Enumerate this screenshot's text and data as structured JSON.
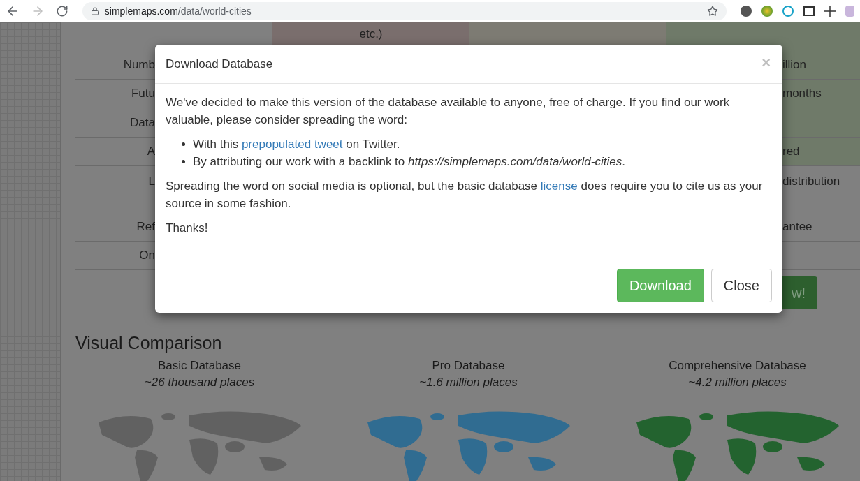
{
  "browser": {
    "url_host": "simplemaps.com",
    "url_path": "/data/world-cities"
  },
  "table": {
    "header_fragment": "etc.)",
    "rows": [
      {
        "label": "Numb",
        "value": "illion",
        "highlighted": true,
        "kind": "single"
      },
      {
        "label": "Futu",
        "value": "months",
        "highlighted": true,
        "kind": "single"
      },
      {
        "label": "Data",
        "highlighted": true,
        "kind": "single"
      },
      {
        "label": "A",
        "value": "red",
        "highlighted": true,
        "kind": "single"
      },
      {
        "label": "L",
        "value": "distribution",
        "highlighted": false,
        "kind": "double"
      },
      {
        "label": "Ref",
        "value": "antee",
        "highlighted": false,
        "kind": "single"
      },
      {
        "label": "On",
        "highlighted": false,
        "kind": "single"
      }
    ],
    "cta_fragment": "w!"
  },
  "comparison": {
    "heading": "Visual Comparison",
    "items": [
      {
        "title": "Basic Database",
        "subtitle": "~26 thousand places"
      },
      {
        "title": "Pro Database",
        "subtitle": "~1.6 million places"
      },
      {
        "title": "Comprehensive Database",
        "subtitle": "~4.2 million places"
      }
    ]
  },
  "modal": {
    "title": "Download Database",
    "close": "×",
    "intro": "We've decided to make this version of the database available to anyone, free of charge. If you find our work valuable, please consider spreading the word:",
    "bullets": [
      {
        "before": "With this ",
        "link": "prepopulated tweet",
        "after": " on Twitter."
      },
      {
        "before": "By attributing our work with a backlink to *https://simplemaps.com/data/world-cities*."
      }
    ],
    "note": {
      "before": "Spreading the word on social media is optional, but the basic database ",
      "link": "license",
      "after": " does require you to cite us as your source in some fashion."
    },
    "thanks": "Thanks!",
    "buttons": [
      {
        "label": "Download",
        "kind": "primary"
      },
      {
        "label": "Close",
        "kind": "default"
      }
    ]
  }
}
